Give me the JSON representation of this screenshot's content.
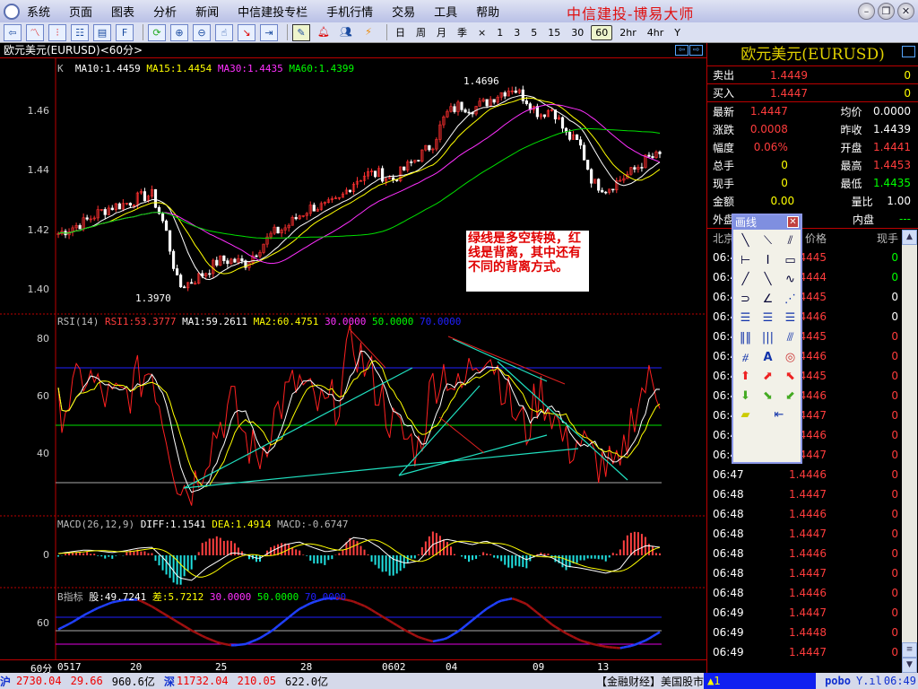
{
  "app": {
    "title": "中信建投-博易大师",
    "menu": [
      "系统",
      "页面",
      "图表",
      "分析",
      "新闻",
      "中信建投专栏",
      "手机行情",
      "交易",
      "工具",
      "帮助"
    ]
  },
  "toolbar": {
    "periods": [
      "日",
      "周",
      "月",
      "季",
      "×",
      "1",
      "3",
      "5",
      "15",
      "30",
      "60",
      "2hr",
      "4hr",
      "Y"
    ],
    "selected_period": "60"
  },
  "chart_title": "欧元美元(EURUSD)<60分>",
  "main": {
    "legend": {
      "k": "K",
      "ma10": "MA10:1.4459",
      "ma15": "MA15:1.4454",
      "ma30": "MA30:1.4435",
      "ma60": "MA60:1.4399"
    },
    "y_ticks": [
      "1.46",
      "1.44",
      "1.42",
      "1.40"
    ],
    "high_label": "1.4696",
    "low_label": "1.3970",
    "note": "绿线是多空转换，红线是背离，其中还有不同的背离方式。"
  },
  "rsi": {
    "legend": {
      "name": "RSI(14)",
      "rsi1": "RSI1:53.3777",
      "ma1": "MA1:59.2611",
      "ma2": "MA2:60.4751",
      "l30": "30.0000",
      "l50": "50.0000",
      "l70": "70.0000"
    },
    "y_ticks": [
      "80",
      "60",
      "40"
    ]
  },
  "macd": {
    "legend": {
      "name": "MACD(26,12,9)",
      "diff": "DIFF:1.1541",
      "dea": "DEA:1.4914",
      "macd": "MACD:-0.6747"
    },
    "y_ticks": [
      "0"
    ]
  },
  "bind": {
    "legend": {
      "name": "B指标",
      "gu": "股:49.7241",
      "cha": "差:5.7212",
      "l30": "30.0000",
      "l50": "50.0000",
      "l70": "70.0000"
    },
    "y_ticks": [
      "60"
    ]
  },
  "xaxis": {
    "period": "60分",
    "labels": [
      "0517",
      "20",
      "25",
      "28",
      "0602",
      "04",
      "09",
      "13"
    ]
  },
  "chart_data": {
    "type": "candlestick",
    "price": [
      1.419,
      1.421,
      1.423,
      1.426,
      1.428,
      1.429,
      1.431,
      1.432,
      1.421,
      1.401,
      1.403,
      1.406,
      1.41,
      1.41,
      1.409,
      1.414,
      1.419,
      1.421,
      1.425,
      1.428,
      1.428,
      1.43,
      1.436,
      1.439,
      1.439,
      1.437,
      1.441,
      1.445,
      1.449,
      1.459,
      1.462,
      1.461,
      1.463,
      1.466,
      1.468,
      1.464,
      1.459,
      1.461,
      1.452,
      1.449,
      1.436,
      1.434,
      1.437,
      1.44,
      1.444,
      1.445
    ],
    "price_ylim": [
      1.39,
      1.475
    ],
    "rsi": [
      55,
      60,
      68,
      62,
      58,
      60,
      66,
      70,
      50,
      30,
      28,
      40,
      50,
      58,
      45,
      38,
      52,
      60,
      65,
      58,
      55,
      60,
      80,
      70,
      62,
      50,
      45,
      42,
      65,
      70,
      60,
      72,
      78,
      68,
      55,
      48,
      62,
      55,
      42,
      45,
      38,
      36,
      32,
      55,
      65,
      62
    ],
    "rsi_ylim": [
      20,
      90
    ],
    "macd": [
      0.2,
      0.4,
      0.6,
      0.5,
      0.3,
      0.5,
      0.8,
      0.9,
      -0.5,
      -2.5,
      -2.8,
      -1.5,
      -0.6,
      0.3,
      0.1,
      -0.4,
      0.5,
      1.2,
      1.5,
      0.9,
      0.4,
      0.6,
      2.0,
      1.8,
      0.9,
      -0.4,
      -0.9,
      -0.6,
      1.2,
      1.8,
      1.5,
      1.2,
      1.6,
      1.0,
      0.3,
      -0.5,
      0.1,
      -0.3,
      -1.2,
      -1.4,
      -1.7,
      -2.0,
      -1.5,
      0.4,
      1.1,
      0.9
    ],
    "macd_ylim": [
      -3.5,
      3
    ],
    "b": [
      55,
      60,
      66,
      71,
      75,
      77,
      77,
      72,
      66,
      60,
      54,
      49,
      45,
      43,
      44,
      48,
      54,
      62,
      70,
      75,
      78,
      78,
      76,
      72,
      66,
      60,
      54,
      49,
      46,
      48,
      54,
      62,
      70,
      76,
      78,
      74,
      66,
      58,
      52,
      47,
      44,
      42,
      41,
      43,
      47,
      53
    ],
    "b_ylim": [
      38,
      82
    ]
  },
  "quote": {
    "title": "欧元美元(EURUSD)",
    "rows": [
      {
        "l1": "卖出",
        "v1": "1.4449",
        "v2": "0"
      },
      {
        "l1": "买入",
        "v1": "1.4447",
        "v2": "0"
      }
    ],
    "stats": [
      {
        "l1": "最新",
        "v1": "1.4447",
        "l2": "均价",
        "v2": "0.0000"
      },
      {
        "l1": "涨跌",
        "v1": "0.0008",
        "l2": "昨收",
        "v2": "1.4439"
      },
      {
        "l1": "幅度",
        "v1": "0.06%",
        "l2": "开盘",
        "v2": "1.4441"
      },
      {
        "l1": "总手",
        "v1": "0",
        "l2": "最高",
        "v2": "1.4453"
      },
      {
        "l1": "现手",
        "v1": "0",
        "l2": "最低",
        "v2": "1.4435"
      },
      {
        "l1": "金额",
        "v1": "0.00",
        "l2": "量比",
        "v2": "1.00"
      },
      {
        "l1": "外盘",
        "v1": "0",
        "l2": "内盘",
        "v2": "---"
      }
    ],
    "tick_headers": [
      "北京",
      "价格",
      "现手"
    ],
    "ticks": [
      [
        "06:47",
        "1.4445",
        "0"
      ],
      [
        "06:47",
        "1.4444",
        "0"
      ],
      [
        "06:47",
        "1.4445",
        "0"
      ],
      [
        "06:47",
        "1.4446",
        "0"
      ],
      [
        "06:47",
        "1.4445",
        "0"
      ],
      [
        "06:47",
        "1.4446",
        "0"
      ],
      [
        "06:47",
        "1.4445",
        "0"
      ],
      [
        "06:47",
        "1.4446",
        "0"
      ],
      [
        "06:47",
        "1.4447",
        "0"
      ],
      [
        "06:47",
        "1.4446",
        "0"
      ],
      [
        "06:47",
        "1.4447",
        "0"
      ],
      [
        "06:47",
        "1.4446",
        "0"
      ],
      [
        "06:48",
        "1.4447",
        "0"
      ],
      [
        "06:48",
        "1.4446",
        "0"
      ],
      [
        "06:48",
        "1.4447",
        "0"
      ],
      [
        "06:48",
        "1.4446",
        "0"
      ],
      [
        "06:48",
        "1.4447",
        "0"
      ],
      [
        "06:48",
        "1.4446",
        "0"
      ],
      [
        "06:49",
        "1.4447",
        "0"
      ],
      [
        "06:49",
        "1.4448",
        "0"
      ],
      [
        "06:49",
        "1.4447",
        "0"
      ]
    ]
  },
  "toolbox": {
    "title": "画线"
  },
  "status": {
    "sh_label": "沪",
    "sh_index": "2730.04",
    "sh_change": "29.66",
    "sh_amount": "960.6亿",
    "sz_label": "深",
    "sz_index": "11732.04",
    "sz_change": "210.05",
    "sz_amount": "622.0亿",
    "news": "【金融财经】美国股市",
    "alert": "▲1",
    "brand": "pobo",
    "time": "06:49"
  }
}
